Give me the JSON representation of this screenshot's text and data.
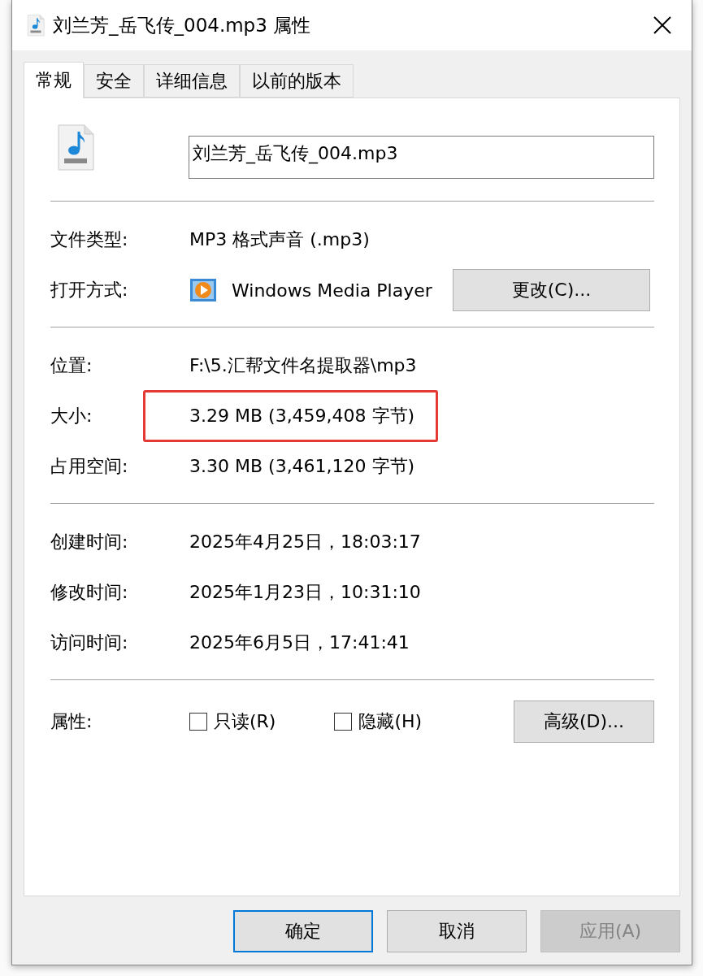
{
  "window": {
    "title": "刘兰芳_岳飞传_004.mp3 属性"
  },
  "tabs": [
    {
      "label": "常规",
      "selected": true
    },
    {
      "label": "安全",
      "selected": false
    },
    {
      "label": "详细信息",
      "selected": false
    },
    {
      "label": "以前的版本",
      "selected": false
    }
  ],
  "file_name": {
    "value": "刘兰芳_岳飞传_004.mp3"
  },
  "sections": [
    [
      {
        "kind": "text",
        "label": "文件类型:",
        "value": "MP3 格式声音 (.mp3)",
        "highlighted": false
      },
      {
        "kind": "app",
        "label": "打开方式:",
        "value": "Windows Media Player",
        "button": "更改(C)..."
      }
    ],
    [
      {
        "kind": "text",
        "label": "位置:",
        "value": "F:\\5.汇帮文件名提取器\\mp3",
        "highlighted": false
      },
      {
        "kind": "text",
        "label": "大小:",
        "value": "3.29 MB (3,459,408 字节)",
        "highlighted": true
      },
      {
        "kind": "text",
        "label": "占用空间:",
        "value": "3.30 MB (3,461,120 字节)",
        "highlighted": false
      }
    ],
    [
      {
        "kind": "text",
        "label": "创建时间:",
        "value": "2025年4月25日，18:03:17",
        "highlighted": false
      },
      {
        "kind": "text",
        "label": "修改时间:",
        "value": "2025年1月23日，10:31:10",
        "highlighted": false
      },
      {
        "kind": "text",
        "label": "访问时间:",
        "value": "2025年6月5日，17:41:41",
        "highlighted": false
      }
    ],
    [
      {
        "kind": "attributes",
        "label": "属性:",
        "checkboxes": [
          {
            "label": "只读(R)",
            "checked": false
          },
          {
            "label": "隐藏(H)",
            "checked": false
          }
        ],
        "button": "高级(D)..."
      }
    ]
  ],
  "buttons": [
    {
      "label": "确定",
      "default": true,
      "disabled": false
    },
    {
      "label": "取消",
      "default": false,
      "disabled": false
    },
    {
      "label": "应用(A)",
      "default": false,
      "disabled": true
    }
  ]
}
